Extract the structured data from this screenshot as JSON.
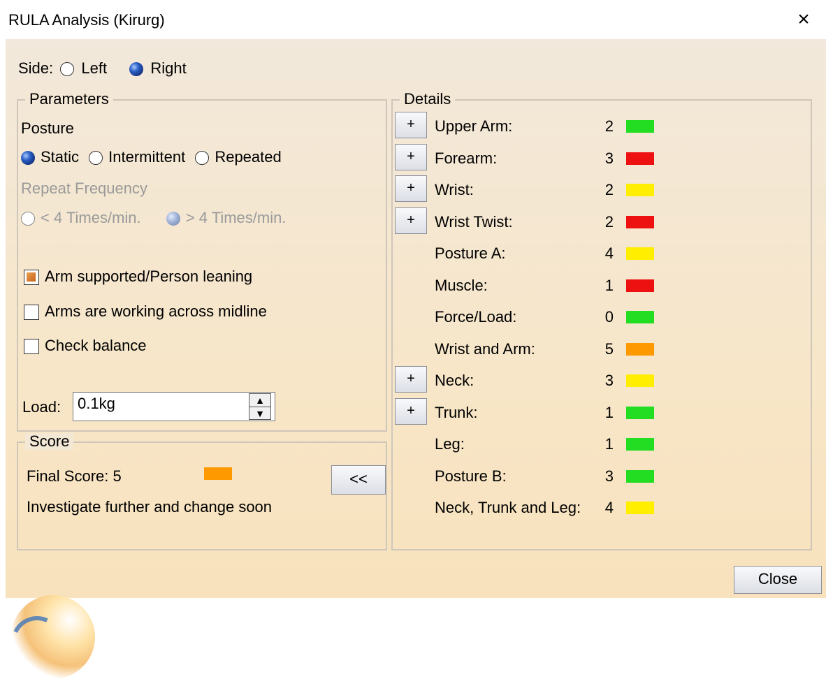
{
  "window": {
    "title": "RULA Analysis (Kirurg)",
    "close_glyph": "×"
  },
  "side": {
    "label": "Side:",
    "options": [
      {
        "label": "Left",
        "selected": false
      },
      {
        "label": "Right",
        "selected": true
      }
    ]
  },
  "parameters": {
    "title": "Parameters",
    "posture": {
      "label": "Posture",
      "options": [
        {
          "label": "Static",
          "selected": true
        },
        {
          "label": "Intermittent",
          "selected": false
        },
        {
          "label": "Repeated",
          "selected": false
        }
      ]
    },
    "repeat_frequency": {
      "label": "Repeat Frequency",
      "enabled": false,
      "options": [
        {
          "label": "< 4 Times/min.",
          "selected": false
        },
        {
          "label": "> 4 Times/min.",
          "selected": true
        }
      ]
    },
    "checkboxes": [
      {
        "label": "Arm supported/Person leaning",
        "checked": true
      },
      {
        "label": "Arms are working across midline",
        "checked": false
      },
      {
        "label": "Check balance",
        "checked": false
      }
    ],
    "load": {
      "label": "Load:",
      "value": "0.1kg"
    }
  },
  "score": {
    "title": "Score",
    "final_label": "Final Score: 5",
    "color": "#ff9900",
    "message": "Investigate further and change soon",
    "collapse_button": "<<"
  },
  "details": {
    "title": "Details",
    "rows": [
      {
        "label": "Upper Arm:",
        "value": "2",
        "color": "#22dd22",
        "expandable": true
      },
      {
        "label": "Forearm:",
        "value": "3",
        "color": "#ee1111",
        "expandable": true
      },
      {
        "label": "Wrist:",
        "value": "2",
        "color": "#ffee00",
        "expandable": true
      },
      {
        "label": "Wrist Twist:",
        "value": "2",
        "color": "#ee1111",
        "expandable": true
      },
      {
        "label": "Posture A:",
        "value": "4",
        "color": "#ffee00",
        "expandable": false
      },
      {
        "label": "Muscle:",
        "value": "1",
        "color": "#ee1111",
        "expandable": false
      },
      {
        "label": "Force/Load:",
        "value": "0",
        "color": "#22dd22",
        "expandable": false
      },
      {
        "label": "Wrist and Arm:",
        "value": "5",
        "color": "#ff9900",
        "expandable": false
      },
      {
        "label": "Neck:",
        "value": "3",
        "color": "#ffee00",
        "expandable": true
      },
      {
        "label": "Trunk:",
        "value": "1",
        "color": "#22dd22",
        "expandable": true
      },
      {
        "label": "Leg:",
        "value": "1",
        "color": "#22dd22",
        "expandable": false
      },
      {
        "label": "Posture B:",
        "value": "3",
        "color": "#22dd22",
        "expandable": false
      },
      {
        "label": "Neck, Trunk and Leg:",
        "value": "4",
        "color": "#ffee00",
        "expandable": false
      }
    ],
    "expand_label": "+"
  },
  "footer": {
    "close_button": "Close"
  }
}
